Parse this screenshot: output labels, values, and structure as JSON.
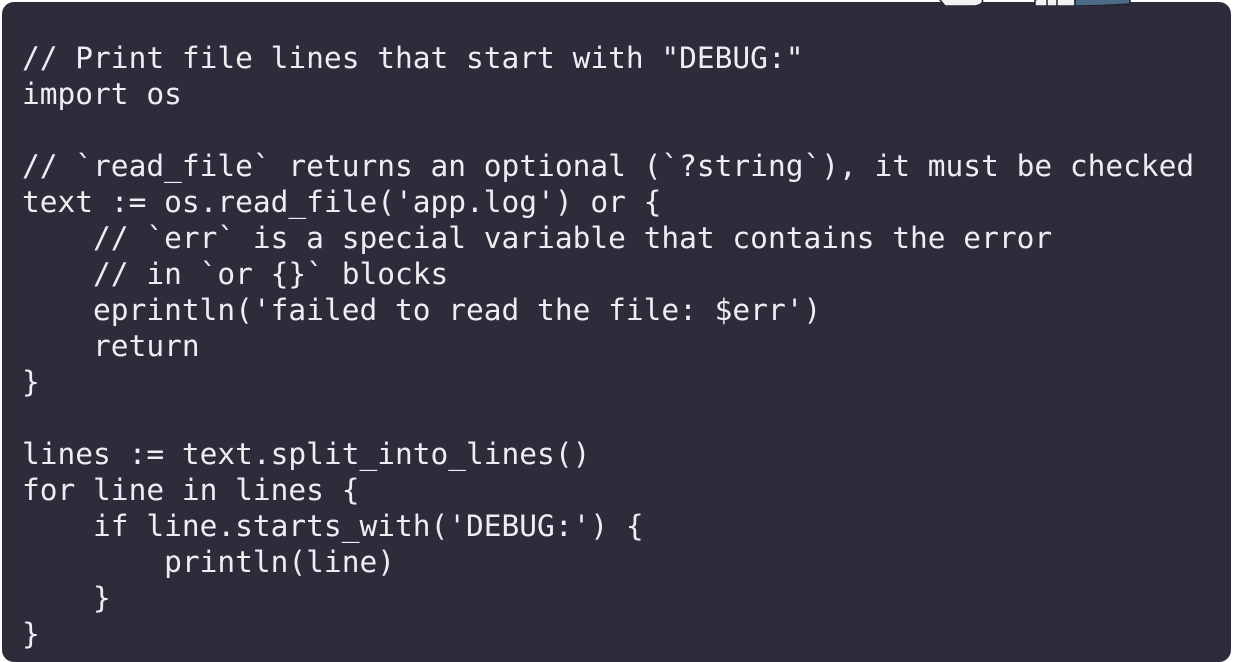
{
  "code": {
    "lines": [
      "// Print file lines that start with \"DEBUG:\"",
      "import os",
      "",
      "// `read_file` returns an optional (`?string`), it must be checked",
      "text := os.read_file('app.log') or {",
      "    // `err` is a special variable that contains the error",
      "    // in `or {}` blocks",
      "    eprintln('failed to read the file: $err')",
      "    return",
      "}",
      "",
      "lines := text.split_into_lines()",
      "for line in lines {",
      "    if line.starts_with('DEBUG:') {",
      "        println(line)",
      "    }",
      "}"
    ]
  },
  "colors": {
    "panel_background": "#2d2c3a",
    "code_text": "#ededf2",
    "page_background": "#ffffff"
  },
  "decoration": {
    "icon": "mascot-illustration-icon"
  }
}
